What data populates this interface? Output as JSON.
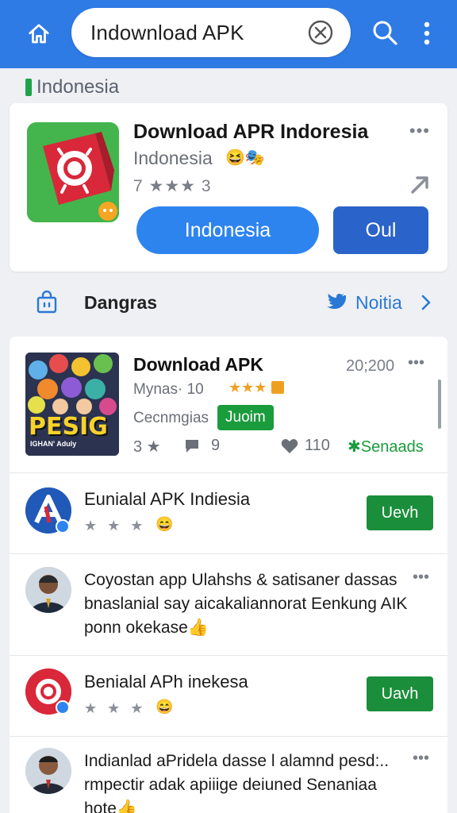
{
  "header": {
    "search_value": "Indownload APK"
  },
  "region": {
    "label": "Indonesia",
    "accent": "#1ea34a"
  },
  "featured": {
    "title": "Download APR Indoresia",
    "subtitle": "Indonesia",
    "emoji": "😆🎭",
    "rating": "7 ★★★ 3",
    "more": "•••",
    "primary_button": "Indonesia",
    "secondary_button": "Oul"
  },
  "category": {
    "label": "Dangras",
    "link": "Noitia"
  },
  "list": {
    "row1": {
      "title": "Download APK",
      "count": "20;200",
      "more": "•••",
      "sub": "Mynas· 10",
      "stars": "★★★",
      "dev": "Cecnmgias",
      "badge": "Juoim",
      "stats_rating": "3 ★",
      "stats_comments": "9",
      "stats_likes": "110",
      "stats_tag": "✱Senaads",
      "thumb_text": "PESIG",
      "thumb_sub": "IGHAN' Aduly"
    },
    "row2": {
      "title": "Eunialal APK Indiesia",
      "stars": "★ ★ ★",
      "button": "Uevh"
    },
    "row3": {
      "line1": "Coyostan app Ulahshs & satisaner dassas",
      "line2": "bnaslanial say aicakaliannorat Eenkung AIK",
      "line3": "ponn okekase👍",
      "more": "•••"
    },
    "row4": {
      "title": "Benialal APh inekesa",
      "stars": "★ ★ ★",
      "button": "Uavh"
    },
    "row5": {
      "line1": "Indianlad aPridela dasse l alamnd pesd:..",
      "line2": "rmpectir adak apiiige deiuned Senaniaa",
      "line3": "hote👍",
      "more": "•••"
    }
  },
  "colors": {
    "topbar": "#2f7be6",
    "primary": "#2e84ef",
    "secondary": "#2a63c9",
    "green": "#1a8e3a"
  }
}
